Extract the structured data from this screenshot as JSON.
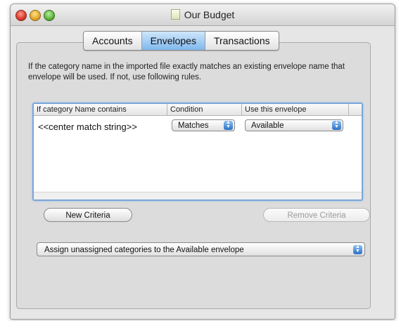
{
  "window": {
    "title": "Our Budget"
  },
  "tabs": [
    {
      "label": "Accounts",
      "active": false
    },
    {
      "label": "Envelopes",
      "active": true
    },
    {
      "label": "Transactions",
      "active": false
    }
  ],
  "info_text": "If the category name in the imported file exactly matches an existing envelope name that envelope will be used.  If not, use following rules.",
  "table": {
    "headers": [
      "If category Name contains",
      "Condition",
      "Use this envelope"
    ],
    "rows": [
      {
        "match": "<<center match string>>",
        "condition": "Matches",
        "envelope": "Available"
      }
    ]
  },
  "buttons": {
    "new_criteria": "New Criteria",
    "remove_criteria": "Remove Criteria"
  },
  "assign_popup": {
    "selected": "Assign unassigned categories to the Available envelope"
  },
  "colors": {
    "accent": "#7fb8ee",
    "focus_ring": "#7aa6d9",
    "close": "#d6392b",
    "minimize": "#e0a52a",
    "zoom": "#5bb33a"
  },
  "icons": {
    "close": "close-icon",
    "minimize": "minimize-icon",
    "zoom": "zoom-icon",
    "document": "document-icon",
    "stepper": "chevron-up-down-icon"
  }
}
